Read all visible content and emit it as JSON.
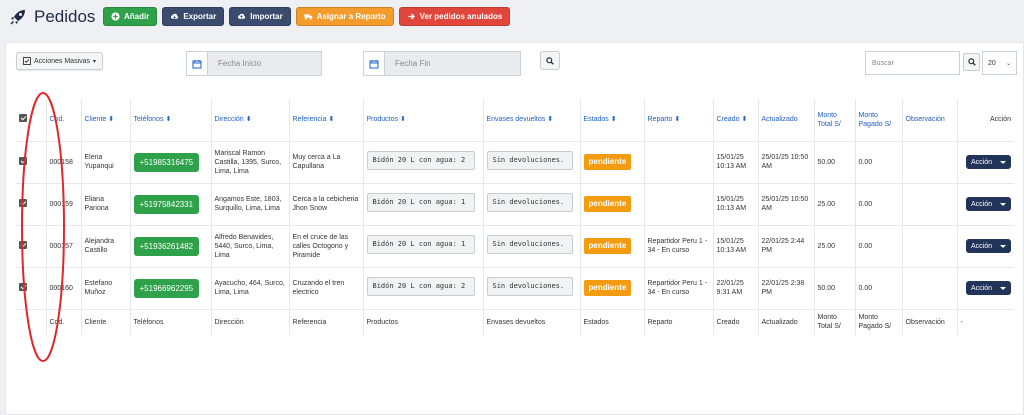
{
  "header": {
    "title": "Pedidos",
    "buttons": {
      "add": "Añadir",
      "export": "Exportar",
      "import": "Importar",
      "assign": "Asignar a Reparto",
      "cancelled": "Ver pedidos anulados"
    }
  },
  "filters": {
    "mass_actions": "Acciones Masivas",
    "date_start_placeholder": "Fecha Inicio",
    "date_end_placeholder": "Fecha Fin",
    "search_placeholder": "Buscar",
    "page_size": "20"
  },
  "table": {
    "headers": {
      "cod": "Cod.",
      "cliente": "Cliente",
      "telefonos": "Teléfonos",
      "direccion": "Dirección",
      "referencia": "Referencia",
      "productos": "Productos",
      "envases": "Envases devueltos",
      "estados": "Estados",
      "reparto": "Reparto",
      "creado": "Creado",
      "actualizado": "Actualizado",
      "monto_total": "Monto Total S/",
      "monto_pagado": "Monto Pagado S/",
      "observacion": "Observación",
      "accion": "Acción"
    },
    "rows": [
      {
        "cod": "000158",
        "cliente": "Elena Yupanqui",
        "telefono": "+51985316475",
        "direccion": "Mariscal Ramon Castilla, 1395, Surco, Lima, Lima",
        "referencia": "Muy cerca a La Capullana",
        "producto": "Bidón 20 L con agua: 2",
        "envases": "Sin devoluciones.",
        "estado": "pendiente",
        "reparto": "",
        "creado": "15/01/25 10:13 AM",
        "actualizado": "25/01/25 10:50 AM",
        "monto_total": "50.00",
        "monto_pagado": "0.00",
        "observacion": "",
        "accion": "Acción"
      },
      {
        "cod": "000159",
        "cliente": "Eliana Pariona",
        "telefono": "+51975842331",
        "direccion": "Angamos Este, 1803, Surquillo, Lima, Lima",
        "referencia": "Cerca a la cebicheria Jhon Snow",
        "producto": "Bidón 20 L con agua: 1",
        "envases": "Sin devoluciones.",
        "estado": "pendiente",
        "reparto": "",
        "creado": "15/01/25 10:13 AM",
        "actualizado": "25/01/25 10:50 AM",
        "monto_total": "25.00",
        "monto_pagado": "0.00",
        "observacion": "",
        "accion": "Acción"
      },
      {
        "cod": "000157",
        "cliente": "Alejandra Castillo",
        "telefono": "+51936261482",
        "direccion": "Alfredo Benavides, 5440, Surco, Lima, Lima",
        "referencia": "En el cruce de las calles Octogono y Piramide",
        "producto": "Bidón 20 L con agua: 1",
        "envases": "Sin devoluciones.",
        "estado": "pendiente",
        "reparto": "Repartidor Peru 1 - 34 - En curso",
        "creado": "15/01/25 10:13 AM",
        "actualizado": "22/01/25 2:44 PM",
        "monto_total": "25.00",
        "monto_pagado": "0.00",
        "observacion": "",
        "accion": "Acción"
      },
      {
        "cod": "000160",
        "cliente": "Estefano Muñoz",
        "telefono": "+51966962295",
        "direccion": "Ayacucho, 464, Surco, Lima, Lima",
        "referencia": "Cruzando el tren electrico",
        "producto": "Bidón 20 L con agua: 2",
        "envases": "Sin devoluciones.",
        "estado": "pendiente",
        "reparto": "Repartidor Peru 1 - 34 - En curso",
        "creado": "22/01/25 9:31 AM",
        "actualizado": "22/01/25 2:38 PM",
        "monto_total": "50.00",
        "monto_pagado": "0.00",
        "observacion": "",
        "accion": "Acción"
      }
    ],
    "footer": {
      "cod": "Cod.",
      "cliente": "Cliente",
      "telefonos": "Teléfonos",
      "direccion": "Dirección",
      "referencia": "Referencia",
      "productos": "Productos",
      "envases": "Envases devueltos",
      "estados": "Estados",
      "reparto": "Reparto",
      "creado": "Creado",
      "actualizado": "Actualizado",
      "monto_total": "Monto Total S/",
      "monto_pagado": "Monto Pagado S/",
      "observacion": "Observación",
      "accion": "-"
    }
  },
  "colors": {
    "green": "#2fa14a",
    "navy": "#3a4b6e",
    "orange": "#f39c2c",
    "red": "#e0463b",
    "badge": "#f39c12",
    "action": "#22345a",
    "annotation": "#e0262d"
  }
}
